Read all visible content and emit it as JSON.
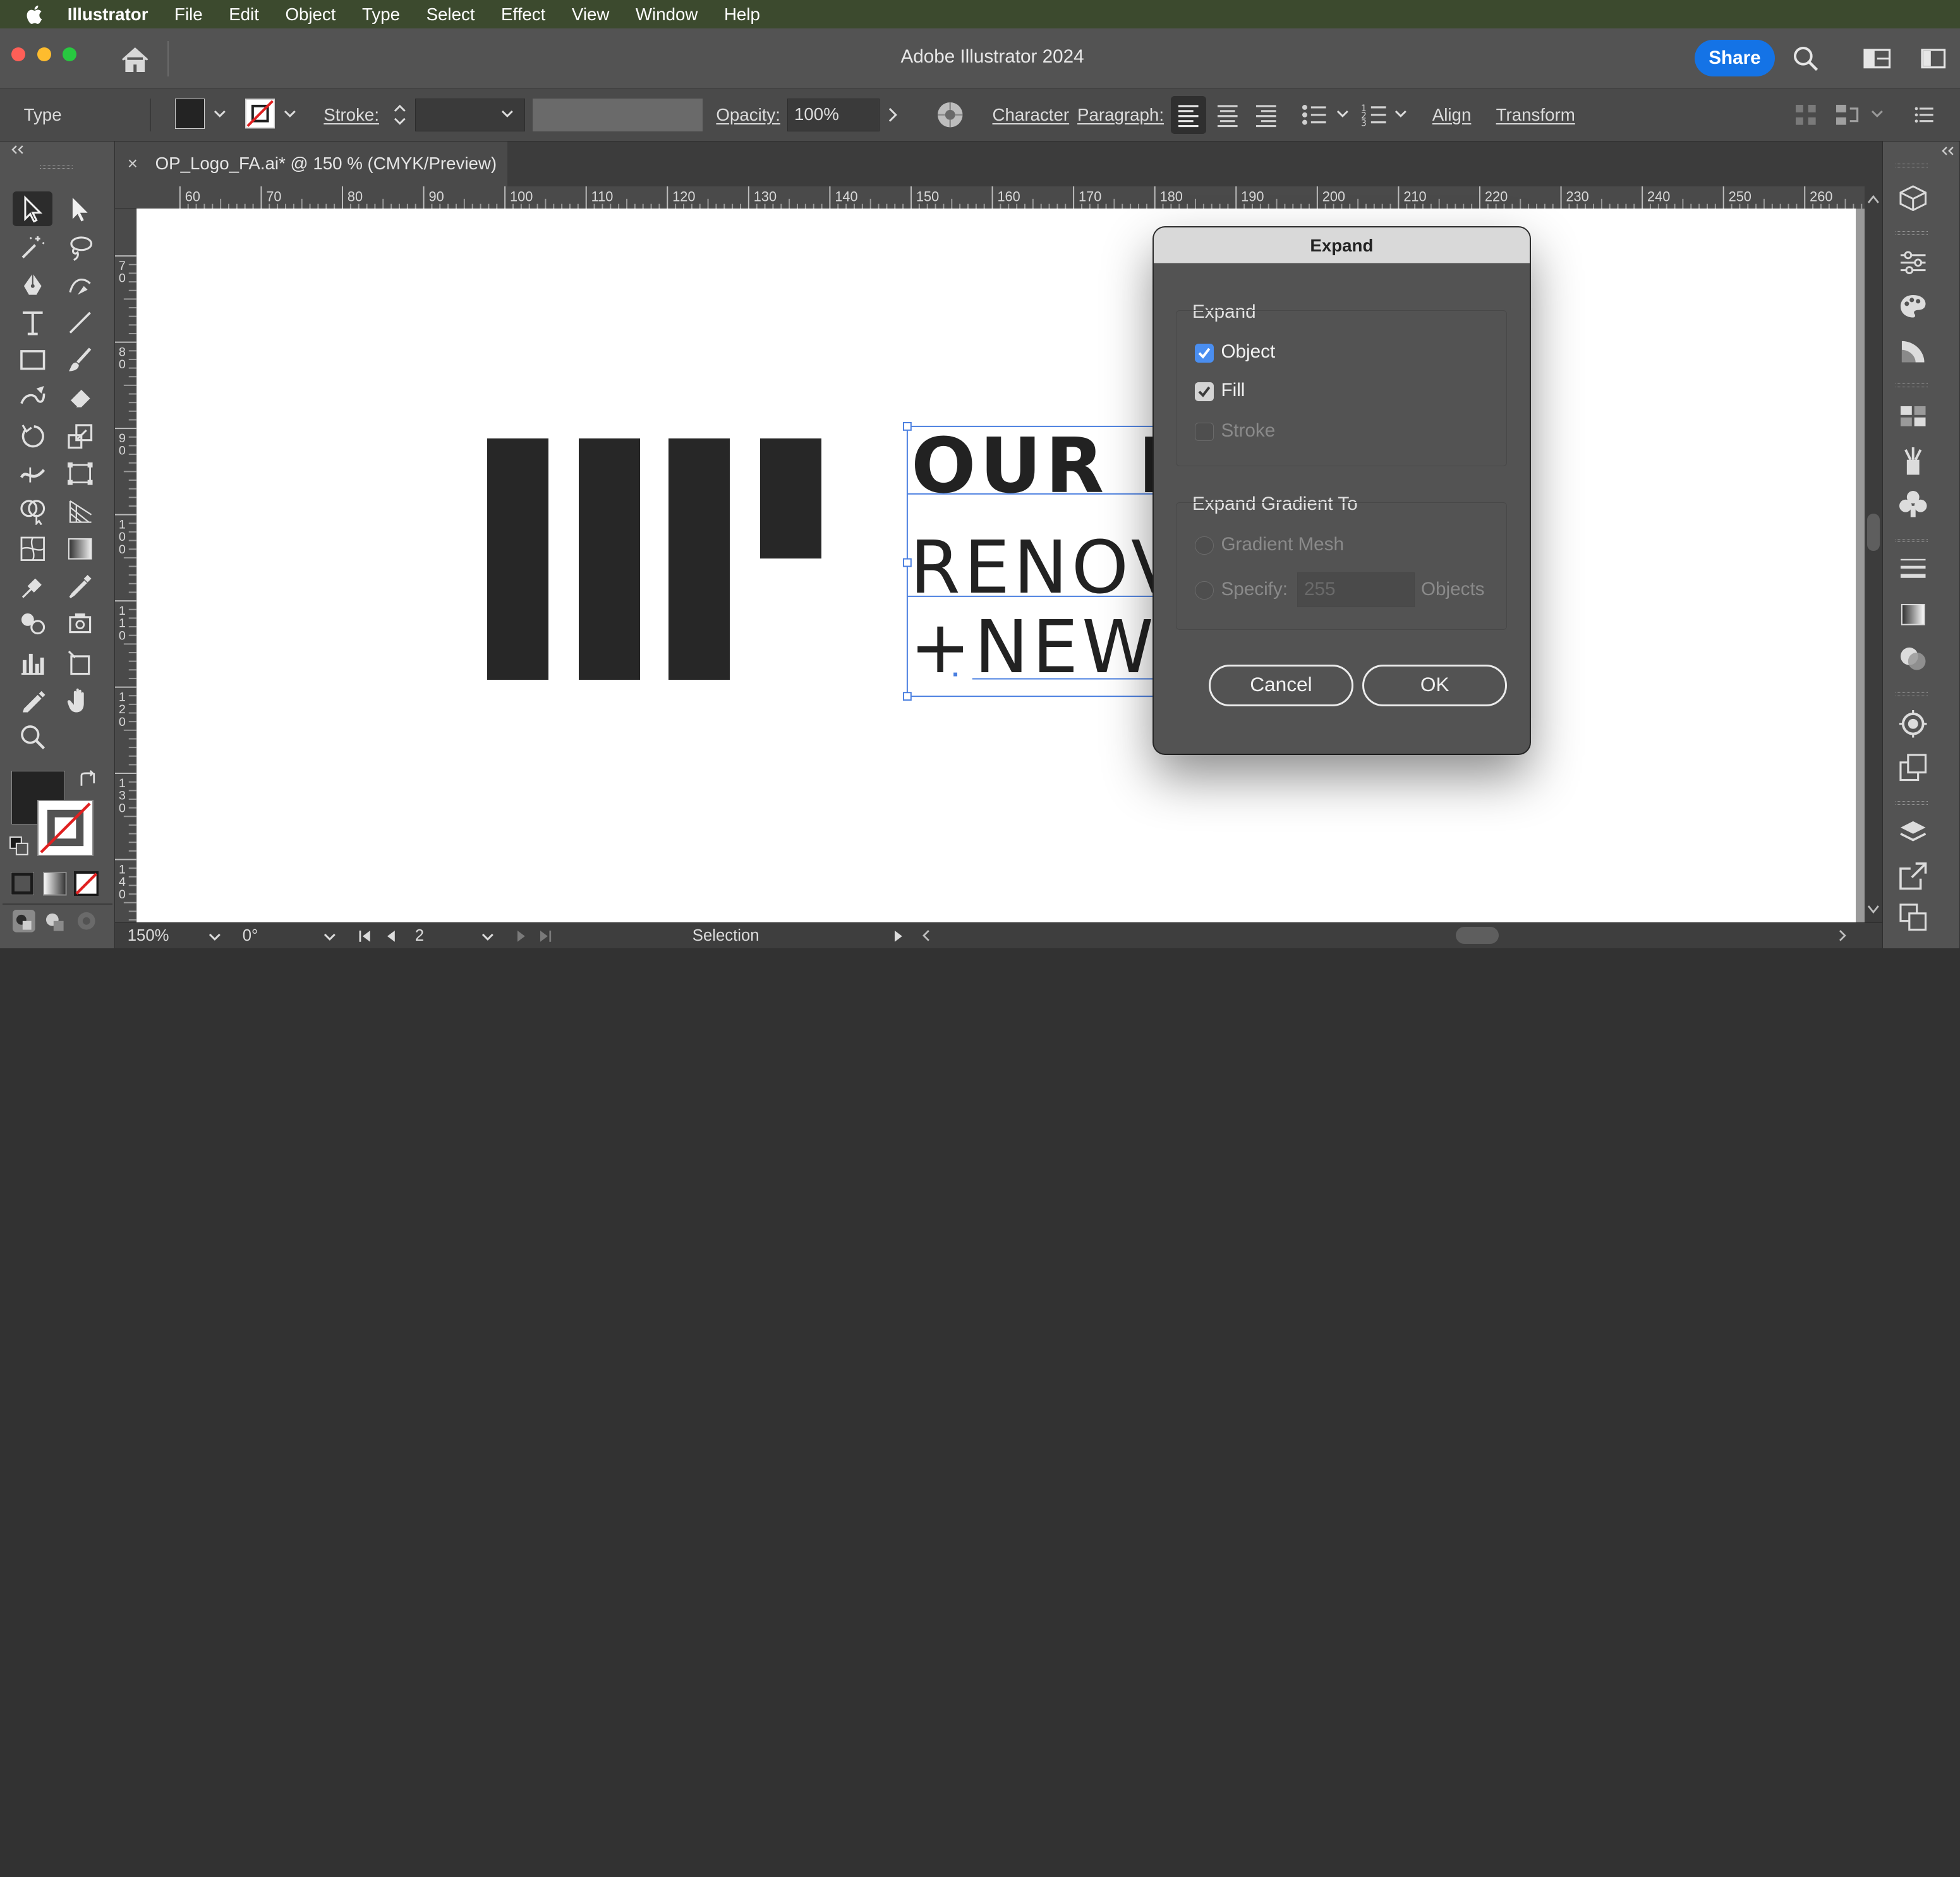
{
  "menu": {
    "app": "Illustrator",
    "items": [
      "File",
      "Edit",
      "Object",
      "Type",
      "Select",
      "Effect",
      "View",
      "Window",
      "Help"
    ]
  },
  "window": {
    "title": "Adobe Illustrator 2024",
    "share": "Share"
  },
  "control_bar": {
    "selection_type": "Type",
    "stroke_label": "Stroke:",
    "opacity_label": "Opacity:",
    "opacity_value": "100%",
    "character": "Character",
    "paragraph": "Paragraph:",
    "align": "Align",
    "transform": "Transform"
  },
  "document": {
    "tab_title": "OP_Logo_FA.ai* @ 150 % (CMYK/Preview)",
    "close_glyph": "×"
  },
  "rulers": {
    "h_ticks": [
      "60",
      "70",
      "80",
      "90",
      "100",
      "110",
      "120",
      "130",
      "140",
      "150",
      "160",
      "170",
      "180",
      "190",
      "200",
      "210",
      "220",
      "230",
      "240",
      "250",
      "260"
    ],
    "v_ticks": [
      "7\n0",
      "8\n0",
      "9\n0",
      "1\n0\n0",
      "1\n1\n0",
      "1\n2\n0",
      "1\n3\n0",
      "1\n4\n0"
    ]
  },
  "artwork": {
    "line1": "OUR PL",
    "line2": "RENOV",
    "line3": "+NEW",
    "ink_color": "#272727",
    "selection_color": "#4a7fe0"
  },
  "dialog": {
    "title": "Expand",
    "group1_label": "Expand",
    "object_label": "Object",
    "object_checked": true,
    "fill_label": "Fill",
    "fill_checked": true,
    "stroke_label": "Stroke",
    "stroke_checked": false,
    "group2_label": "Expand Gradient To",
    "gradient_mesh_label": "Gradient Mesh",
    "specify_label": "Specify:",
    "specify_value": "255",
    "objects_label": "Objects",
    "cancel": "Cancel",
    "ok": "OK"
  },
  "status_bar": {
    "zoom": "150%",
    "rotation": "0°",
    "artboard_num": "2",
    "tool": "Selection"
  },
  "colors": {
    "accent": "#1473e6",
    "menubar": "#3c4a2e",
    "panel": "#535353"
  }
}
